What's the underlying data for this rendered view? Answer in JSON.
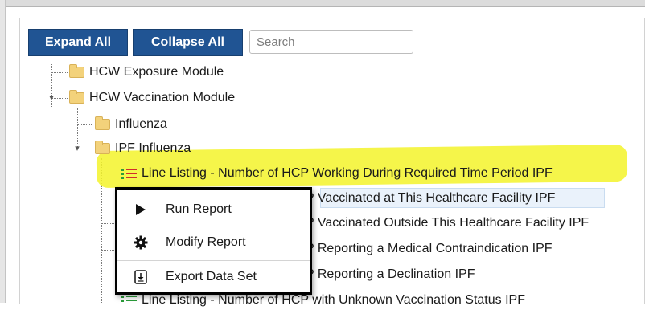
{
  "toolbar": {
    "expand_label": "Expand All",
    "collapse_label": "Collapse All",
    "search_placeholder": "Search"
  },
  "tree": {
    "hcw_exposure": "HCW Exposure Module",
    "hcw_vaccination": "HCW Vaccination Module",
    "influenza": "Influenza",
    "ipf_influenza": "IPF Influenza",
    "reports": [
      "Line Listing - Number of HCP Working During Required Time Period IPF",
      "P Vaccinated at This Healthcare Facility IPF",
      "P Vaccinated Outside This Healthcare Facility IPF",
      "P Reporting a Medical Contraindication IPF",
      "P Reporting a Declination IPF",
      "Line Listing - Number of HCP with Unknown Vaccination Status IPF"
    ]
  },
  "context_menu": {
    "run": "Run Report",
    "modify": "Modify Report",
    "export": "Export Data Set"
  },
  "colors": {
    "button_bg": "#205493",
    "highlight": "#f3f32a",
    "icon_green": "#2a9d3a",
    "icon_red": "#d12c2c"
  }
}
